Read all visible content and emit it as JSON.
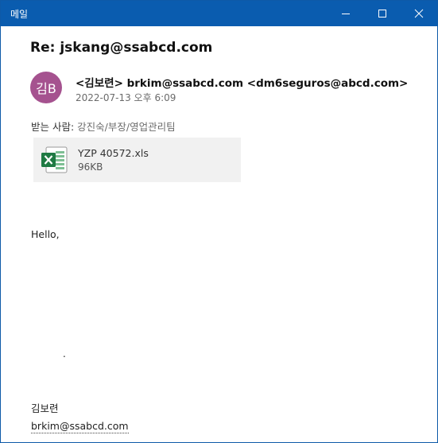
{
  "window": {
    "title": "메일",
    "controls": [
      "minimize-icon",
      "maximize-icon",
      "close-icon"
    ],
    "titlebar_color": "#0a5caf"
  },
  "email": {
    "subject": "Re:  jskang@ssabcd.com",
    "avatar": {
      "initials": "김B",
      "color": "#a5528f"
    },
    "from": "<김보련> brkim@ssabcd.com <dm6seguros@abcd.com>",
    "date": "2022-07-13 오후 6:09",
    "to_label": "받는 사람:",
    "to_value": "강진숙/부장/영업관리팀",
    "attachment": {
      "icon": "excel-file-icon",
      "name": "YZP 40572.xls",
      "size": "96KB"
    },
    "body": {
      "greeting": "Hello,",
      "dot": "."
    },
    "signature": {
      "name": "김보련",
      "email": "brkim@ssabcd.com"
    }
  }
}
